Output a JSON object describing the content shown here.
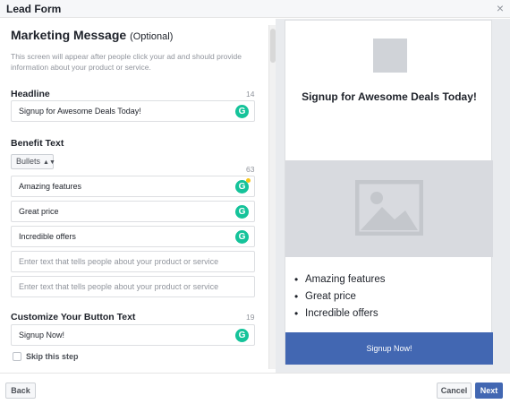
{
  "window": {
    "title": "Lead Form",
    "close_glyph": "×"
  },
  "form": {
    "section_title": "Marketing Message",
    "section_optional": "(Optional)",
    "description": "This screen will appear after people click your ad and should provide information about your product or service.",
    "headline": {
      "label": "Headline",
      "count": "14",
      "value": "Signup for Awesome Deals Today!"
    },
    "benefit": {
      "label": "Benefit Text",
      "format_select": "Bullets",
      "count": "63",
      "items": [
        "Amazing features",
        "Great price",
        "Incredible offers"
      ],
      "placeholders": [
        "Enter text that tells people about your product or service",
        "Enter text that tells people about your product or service"
      ]
    },
    "button_text": {
      "label": "Customize Your Button Text",
      "count": "19",
      "value": "Signup Now!"
    },
    "skip_label": "Skip this step"
  },
  "grammarly_icon": "G",
  "preview": {
    "headline": "Signup for Awesome Deals Today!",
    "bullets": [
      "Amazing features",
      "Great price",
      "Incredible offers"
    ],
    "button_label": "Signup Now!"
  },
  "footer": {
    "back_label": "Back",
    "cancel_label": "Cancel",
    "next_label": "Next"
  },
  "colors": {
    "accent": "#4267b2",
    "grammarly": "#15c39a",
    "placeholder_gray": "#d8dadf"
  }
}
